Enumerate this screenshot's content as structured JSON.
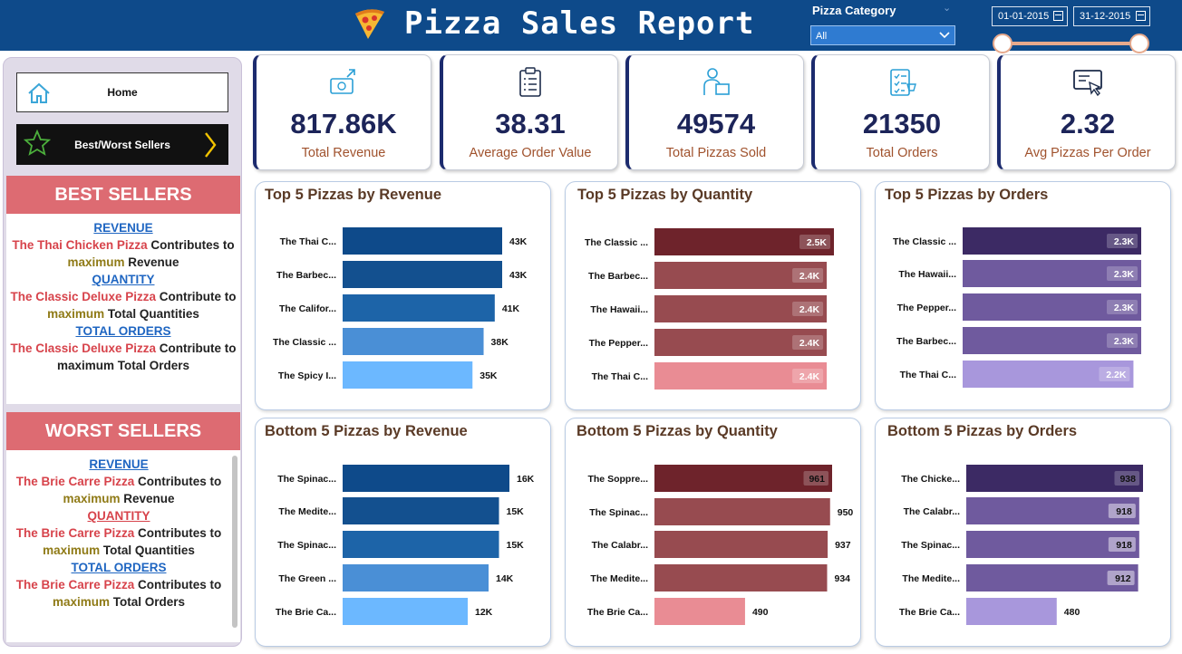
{
  "header": {
    "title": "Pizza Sales Report",
    "category_label": "Pizza Category",
    "category_value": "All",
    "date_start": "01-01-2015",
    "date_end": "31-12-2015"
  },
  "nav": {
    "home": "Home",
    "best_worst": "Best/Worst Sellers"
  },
  "best": {
    "heading": "BEST SELLERS",
    "revenue_hdr": "REVENUE",
    "revenue_pizza": "The Thai Chicken Pizza",
    "revenue_t1": "Contributes to",
    "revenue_max": "maximum",
    "revenue_t2": "Revenue",
    "quantity_hdr": "QUANTITY",
    "quantity_pizza": "The Classic Deluxe Pizza",
    "quantity_t1": "Contribute to",
    "quantity_max": "maximum",
    "quantity_t2": "Total Quantities",
    "orders_hdr": "TOTAL ORDERS",
    "orders_pizza": "The Classic Deluxe Pizza",
    "orders_t1": "Contribute to maximum Total Orders"
  },
  "worst": {
    "heading": "WORST SELLERS",
    "revenue_hdr": "REVENUE",
    "revenue_pizza": "The Brie Carre Pizza",
    "revenue_t1": "Contributes to",
    "revenue_max": "maximum",
    "revenue_t2": "Revenue",
    "quantity_hdr": "QUANTITY",
    "quantity_pizza": "The Brie Carre Pizza",
    "quantity_t1": "Contributes to",
    "quantity_max": "maximum",
    "quantity_t2": "Total Quantities",
    "orders_hdr": "TOTAL ORDERS",
    "orders_pizza": "The Brie Carre Pizza",
    "orders_t1": "Contributes to",
    "orders_max": "maximum",
    "orders_t2": "Total Orders"
  },
  "kpis": [
    {
      "value": "817.86K",
      "label": "Total Revenue",
      "icon": "money-icon"
    },
    {
      "value": "38.31",
      "label": "Average Order Value",
      "icon": "clipboard-icon"
    },
    {
      "value": "49574",
      "label": "Total Pizzas Sold",
      "icon": "delivery-icon"
    },
    {
      "value": "21350",
      "label": "Total Orders",
      "icon": "checklist-icon"
    },
    {
      "value": "2.32",
      "label": "Avg Pizzas Per Order",
      "icon": "order-tablet-icon"
    }
  ],
  "colors": {
    "header_bg": "#0e4a8a",
    "best_head": "#dd6b72",
    "revenue_blues": [
      "#0e4a8a",
      "#13508f",
      "#1d64a8",
      "#4a8fd6",
      "#6cb8ff"
    ],
    "quantity_reds": [
      "#6e232b",
      "#974b50",
      "#974b50",
      "#974b50",
      "#e98c94"
    ],
    "orders_purples": [
      "#3c2a64",
      "#6f5a9e",
      "#6f5a9e",
      "#6f5a9e",
      "#a897dc"
    ]
  },
  "chart_data": [
    {
      "type": "bar",
      "orientation": "horizontal",
      "title": "Top 5 Pizzas by Revenue",
      "categories": [
        "The Thai C...",
        "The Barbec...",
        "The Califor...",
        "The Classic ...",
        "The Spicy I..."
      ],
      "values": [
        43,
        43,
        41,
        38,
        35
      ],
      "value_labels": [
        "43K",
        "43K",
        "41K",
        "38K",
        "35K"
      ],
      "label_style": "outside"
    },
    {
      "type": "bar",
      "orientation": "horizontal",
      "title": "Top 5 Pizzas by Quantity",
      "categories": [
        "The Classic ...",
        "The Barbec...",
        "The Hawaii...",
        "The Pepper...",
        "The Thai C..."
      ],
      "values": [
        2.5,
        2.4,
        2.4,
        2.4,
        2.4
      ],
      "value_labels": [
        "2.5K",
        "2.4K",
        "2.4K",
        "2.4K",
        "2.4K"
      ],
      "label_style": "inside"
    },
    {
      "type": "bar",
      "orientation": "horizontal",
      "title": "Top 5 Pizzas by Orders",
      "categories": [
        "The Classic ...",
        "The Hawaii...",
        "The Pepper...",
        "The Barbec...",
        "The Thai C..."
      ],
      "values": [
        2.3,
        2.3,
        2.3,
        2.3,
        2.2
      ],
      "value_labels": [
        "2.3K",
        "2.3K",
        "2.3K",
        "2.3K",
        "2.2K"
      ],
      "label_style": "inside"
    },
    {
      "type": "bar",
      "orientation": "horizontal",
      "title": "Bottom 5 Pizzas by Revenue",
      "categories": [
        "The Spinac...",
        "The Medite...",
        "The Spinac...",
        "The Green ...",
        "The Brie Ca..."
      ],
      "values": [
        16,
        15,
        15,
        14,
        12
      ],
      "value_labels": [
        "16K",
        "15K",
        "15K",
        "14K",
        "12K"
      ],
      "label_style": "outside"
    },
    {
      "type": "bar",
      "orientation": "horizontal",
      "title": "Bottom 5 Pizzas by Quantity",
      "categories": [
        "The Soppre...",
        "The Spinac...",
        "The Calabr...",
        "The Medite...",
        "The Brie Ca..."
      ],
      "values": [
        961,
        950,
        937,
        934,
        490
      ],
      "value_labels": [
        "961",
        "950",
        "937",
        "934",
        "490"
      ],
      "label_style": "mixed"
    },
    {
      "type": "bar",
      "orientation": "horizontal",
      "title": "Bottom 5 Pizzas by Orders",
      "categories": [
        "The Chicke...",
        "The Calabr...",
        "The Spinac...",
        "The Medite...",
        "The Brie Ca..."
      ],
      "values": [
        938,
        918,
        918,
        912,
        480
      ],
      "value_labels": [
        "938",
        "918",
        "918",
        "912",
        "480"
      ],
      "label_style": "mixed"
    }
  ]
}
